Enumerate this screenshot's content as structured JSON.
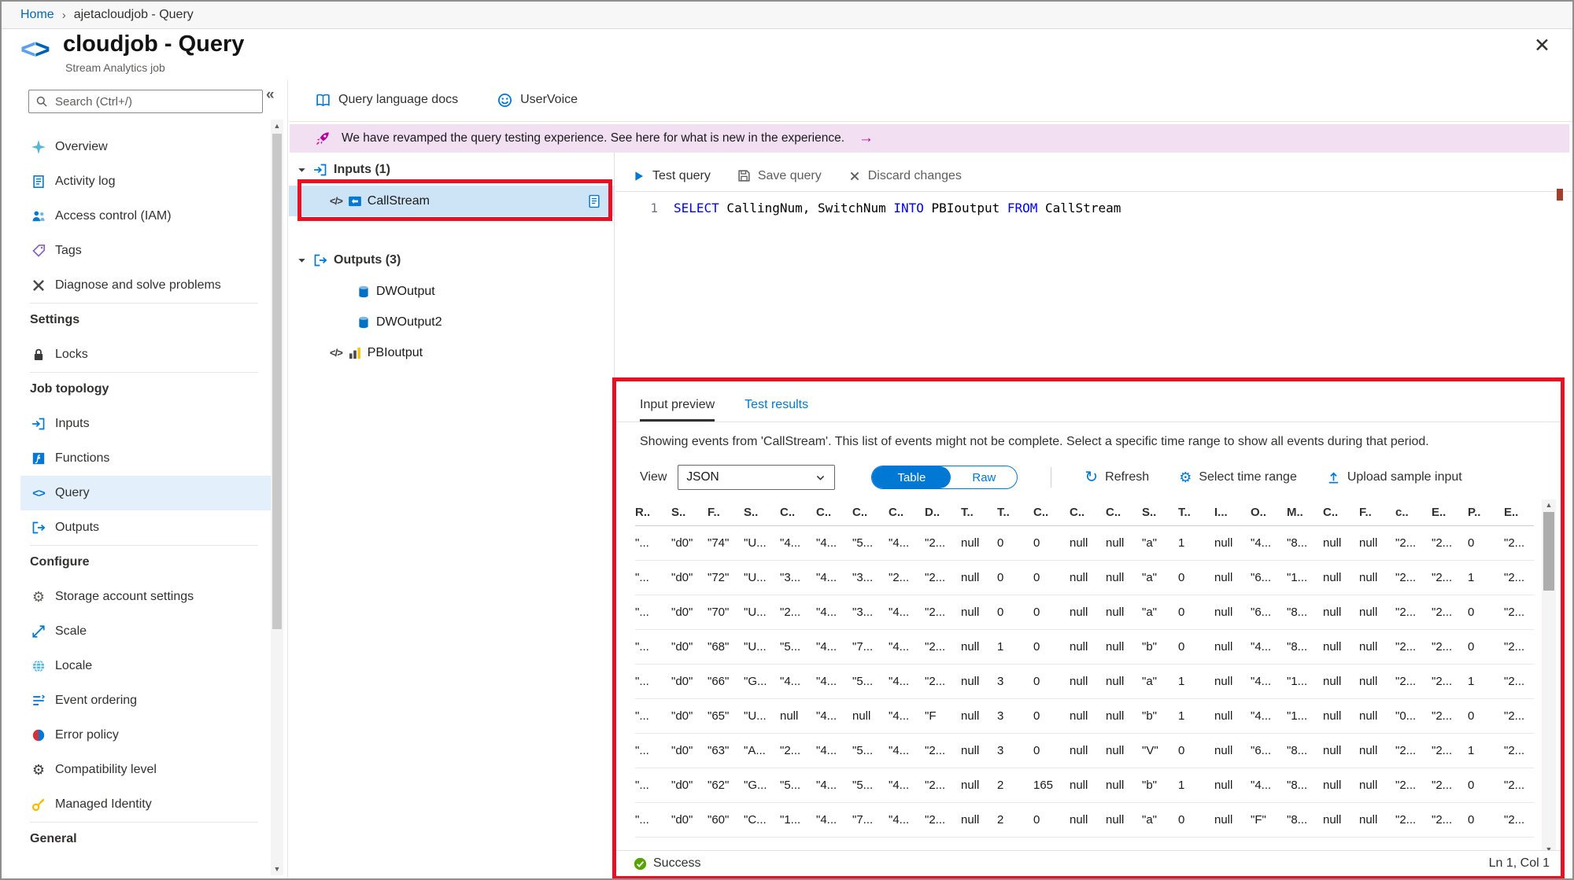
{
  "colors": {
    "accent": "#0078d4",
    "annotation_red": "#e81123",
    "banner_bg": "#f2dff2",
    "selected_item_bg": "#e3f0fb",
    "tree_selected_bg": "#cde4f7",
    "success_green": "#57a300",
    "keyword_blue": "#0000ff"
  },
  "breadcrumb": {
    "home": "Home",
    "separator": "›",
    "current": "ajetacloudjob - Query"
  },
  "header": {
    "brackets_left": "<",
    "brackets_right": ">",
    "title": "cloudjob - Query",
    "subtitle": "Stream Analytics job",
    "close": "✕",
    "collapse": "«"
  },
  "sidebar": {
    "search_placeholder": "Search (Ctrl+/)",
    "items": [
      {
        "label": "Overview",
        "icon": "overview"
      },
      {
        "label": "Activity log",
        "icon": "activity-log"
      },
      {
        "label": "Access control (IAM)",
        "icon": "access-control"
      },
      {
        "label": "Tags",
        "icon": "tags"
      },
      {
        "label": "Diagnose and solve problems",
        "icon": "diagnose"
      },
      {
        "label": "Settings",
        "kind": "header"
      },
      {
        "label": "Locks",
        "icon": "locks"
      },
      {
        "label": "Job topology",
        "kind": "header"
      },
      {
        "label": "Inputs",
        "icon": "inputs"
      },
      {
        "label": "Functions",
        "icon": "functions"
      },
      {
        "label": "Query",
        "icon": "query",
        "selected": true
      },
      {
        "label": "Outputs",
        "icon": "outputs"
      },
      {
        "label": "Configure",
        "kind": "header"
      },
      {
        "label": "Storage account settings",
        "icon": "storage-settings"
      },
      {
        "label": "Scale",
        "icon": "scale"
      },
      {
        "label": "Locale",
        "icon": "locale"
      },
      {
        "label": "Event ordering",
        "icon": "event-ordering"
      },
      {
        "label": "Error policy",
        "icon": "error-policy"
      },
      {
        "label": "Compatibility level",
        "icon": "compatibility-level"
      },
      {
        "label": "Managed Identity",
        "icon": "managed-identity"
      },
      {
        "label": "General",
        "kind": "header"
      }
    ]
  },
  "toolbar": {
    "docs": "Query language docs",
    "uservoice": "UserVoice"
  },
  "banner": {
    "text": "We have revamped the query testing experience. See here for what is new in the experience.",
    "arrow": "→"
  },
  "tree": {
    "groups": [
      {
        "label": "Inputs (1)",
        "icon": "inputs",
        "items": [
          {
            "label": "CallStream",
            "icons": [
              "code-brackets",
              "event-hub"
            ],
            "selected": true,
            "trailing": "document"
          }
        ]
      },
      {
        "label": "Outputs (3)",
        "icon": "outputs",
        "items": [
          {
            "label": "DWOutput",
            "icons": [
              "sql-db"
            ]
          },
          {
            "label": "DWOutput2",
            "icons": [
              "sql-db"
            ]
          },
          {
            "label": "PBIoutput",
            "icons": [
              "code-brackets",
              "powerbi"
            ]
          }
        ]
      }
    ]
  },
  "editor": {
    "test_query": "Test query",
    "save_query": "Save query",
    "discard_changes": "Discard changes",
    "line_number": "1",
    "code": [
      {
        "text": "SELECT",
        "type": "keyword"
      },
      {
        "text": " CallingNum, SwitchNum ",
        "type": "plain"
      },
      {
        "text": "INTO",
        "type": "keyword"
      },
      {
        "text": " PBIoutput ",
        "type": "plain"
      },
      {
        "text": "FROM",
        "type": "keyword"
      },
      {
        "text": " CallStream",
        "type": "plain"
      }
    ]
  },
  "preview": {
    "tabs": [
      {
        "label": "Input preview",
        "active": true
      },
      {
        "label": "Test results",
        "active": false
      }
    ],
    "description": "Showing events from 'CallStream'. This list of events might not be complete. Select a specific time range to show all events during that period.",
    "view_label": "View",
    "view_value": "JSON",
    "toggle": {
      "table": "Table",
      "raw": "Raw"
    },
    "refresh": "Refresh",
    "select_time_range": "Select time range",
    "upload_sample_input": "Upload sample input",
    "status": "Success",
    "position": "Ln 1, Col 1",
    "table": {
      "headers": [
        "R..",
        "S..",
        "F..",
        "S..",
        "C..",
        "C..",
        "C..",
        "C..",
        "D..",
        "T..",
        "T..",
        "C..",
        "C..",
        "C..",
        "S..",
        "T..",
        "I...",
        "O..",
        "M..",
        "C..",
        "F..",
        "c..",
        "E..",
        "P..",
        "E.."
      ],
      "rows": [
        [
          "\"...",
          "\"d0\"",
          "\"74\"",
          "\"U...",
          "\"4...",
          "\"4...",
          "\"5...",
          "\"4...",
          "\"2...",
          "null",
          "0",
          "0",
          "null",
          "null",
          "\"a\"",
          "1",
          "null",
          "\"4...",
          "\"8...",
          "null",
          "null",
          "\"2...",
          "\"2...",
          "0",
          "\"2..."
        ],
        [
          "\"...",
          "\"d0\"",
          "\"72\"",
          "\"U...",
          "\"3...",
          "\"4...",
          "\"3...",
          "\"2...",
          "\"2...",
          "null",
          "0",
          "0",
          "null",
          "null",
          "\"a\"",
          "0",
          "null",
          "\"6...",
          "\"1...",
          "null",
          "null",
          "\"2...",
          "\"2...",
          "1",
          "\"2..."
        ],
        [
          "\"...",
          "\"d0\"",
          "\"70\"",
          "\"U...",
          "\"2...",
          "\"4...",
          "\"3...",
          "\"4...",
          "\"2...",
          "null",
          "0",
          "0",
          "null",
          "null",
          "\"a\"",
          "0",
          "null",
          "\"6...",
          "\"8...",
          "null",
          "null",
          "\"2...",
          "\"2...",
          "0",
          "\"2..."
        ],
        [
          "\"...",
          "\"d0\"",
          "\"68\"",
          "\"U...",
          "\"5...",
          "\"4...",
          "\"7...",
          "\"4...",
          "\"2...",
          "null",
          "1",
          "0",
          "null",
          "null",
          "\"b\"",
          "0",
          "null",
          "\"4...",
          "\"8...",
          "null",
          "null",
          "\"2...",
          "\"2...",
          "0",
          "\"2..."
        ],
        [
          "\"...",
          "\"d0\"",
          "\"66\"",
          "\"G...",
          "\"4...",
          "\"4...",
          "\"5...",
          "\"4...",
          "\"2...",
          "null",
          "3",
          "0",
          "null",
          "null",
          "\"a\"",
          "1",
          "null",
          "\"4...",
          "\"1...",
          "null",
          "null",
          "\"2...",
          "\"2...",
          "1",
          "\"2..."
        ],
        [
          "\"...",
          "\"d0\"",
          "\"65\"",
          "\"U...",
          "null",
          "\"4...",
          "null",
          "\"4...",
          "\"F",
          "null",
          "3",
          "0",
          "null",
          "null",
          "\"b\"",
          "1",
          "null",
          "\"4...",
          "\"1...",
          "null",
          "null",
          "\"0...",
          "\"2...",
          "0",
          "\"2..."
        ],
        [
          "\"...",
          "\"d0\"",
          "\"63\"",
          "\"A...",
          "\"2...",
          "\"4...",
          "\"5...",
          "\"4...",
          "\"2...",
          "null",
          "3",
          "0",
          "null",
          "null",
          "\"V\"",
          "0",
          "null",
          "\"6...",
          "\"8...",
          "null",
          "null",
          "\"2...",
          "\"2...",
          "1",
          "\"2..."
        ],
        [
          "\"...",
          "\"d0\"",
          "\"62\"",
          "\"G...",
          "\"5...",
          "\"4...",
          "\"5...",
          "\"4...",
          "\"2...",
          "null",
          "2",
          "165",
          "null",
          "null",
          "\"b\"",
          "1",
          "null",
          "\"4...",
          "\"8...",
          "null",
          "null",
          "\"2...",
          "\"2...",
          "0",
          "\"2..."
        ],
        [
          "\"...",
          "\"d0\"",
          "\"60\"",
          "\"C...",
          "\"1...",
          "\"4...",
          "\"7...",
          "\"4...",
          "\"2...",
          "null",
          "2",
          "0",
          "null",
          "null",
          "\"a\"",
          "0",
          "null",
          "\"F\"",
          "\"8...",
          "null",
          "null",
          "\"2...",
          "\"2...",
          "0",
          "\"2..."
        ]
      ]
    }
  }
}
